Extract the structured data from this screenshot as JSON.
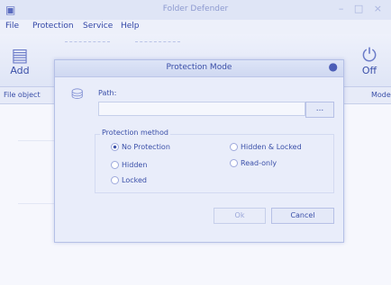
{
  "window": {
    "title": "Folder Defender",
    "controls": "– □ ×"
  },
  "menu": [
    "File",
    "Protection",
    "Service",
    "Help"
  ],
  "toolbar": {
    "add_label": "Add",
    "off_label": "Off"
  },
  "list": {
    "col1": "File object",
    "col2": "Mode"
  },
  "dialog": {
    "title": "Protection Mode",
    "path_label": "Path:",
    "path_value": "",
    "browse_label": "...",
    "group_label": "Protection method",
    "options": [
      {
        "label": "No Protection",
        "selected": true
      },
      {
        "label": "Hidden & Locked",
        "selected": false
      },
      {
        "label": "Hidden",
        "selected": false
      },
      {
        "label": "Read-only",
        "selected": false
      },
      {
        "label": "Locked",
        "selected": false
      }
    ],
    "ok_label": "Ok",
    "cancel_label": "Cancel"
  }
}
